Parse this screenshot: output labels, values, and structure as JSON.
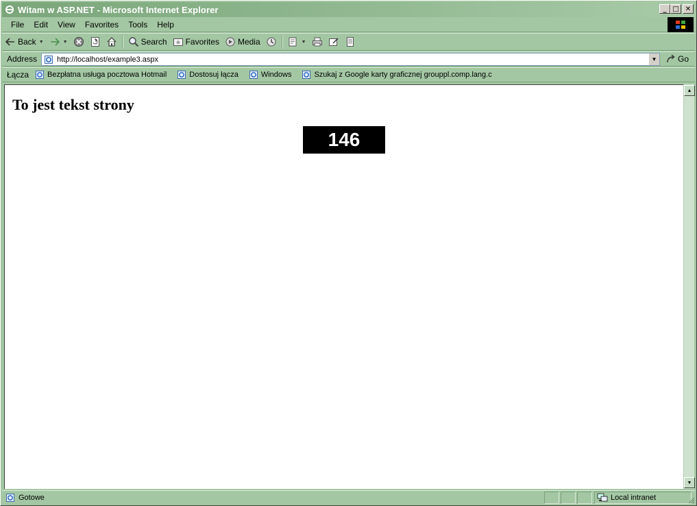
{
  "window": {
    "title": "Witam w ASP.NET - Microsoft Internet Explorer",
    "buttons": {
      "minimize": "_",
      "maximize": "□",
      "close": "✕"
    }
  },
  "menu": {
    "items": [
      {
        "label": "File"
      },
      {
        "label": "Edit"
      },
      {
        "label": "View"
      },
      {
        "label": "Favorites"
      },
      {
        "label": "Tools"
      },
      {
        "label": "Help"
      }
    ]
  },
  "toolbar": {
    "back_label": "Back",
    "search_label": "Search",
    "favorites_label": "Favorites",
    "media_label": "Media",
    "icons": [
      "back-icon",
      "forward-icon",
      "stop-icon",
      "refresh-icon",
      "home-icon",
      "search-icon",
      "favorites-icon",
      "media-icon",
      "history-icon",
      "mail-icon",
      "print-icon",
      "edit-icon",
      "discuss-icon"
    ]
  },
  "address": {
    "label": "Address",
    "value": "http://localhost/example3.aspx",
    "go_label": "Go"
  },
  "links": {
    "label": "Łącza",
    "items": [
      {
        "label": "Bezpłatna usługa pocztowa Hotmail"
      },
      {
        "label": "Dostosuj łącza"
      },
      {
        "label": "Windows"
      },
      {
        "label": "Szukaj z Google karty graficznej grouppl.comp.lang.c"
      }
    ]
  },
  "page": {
    "heading": "To jest tekst strony",
    "counter": "146"
  },
  "status": {
    "text": "Gotowe",
    "zone": "Local intranet"
  },
  "colors": {
    "chrome": "#a3c7a3",
    "title_gradient_start": "#7aa67a",
    "counter_bg": "#000000",
    "counter_fg": "#ffffff"
  }
}
